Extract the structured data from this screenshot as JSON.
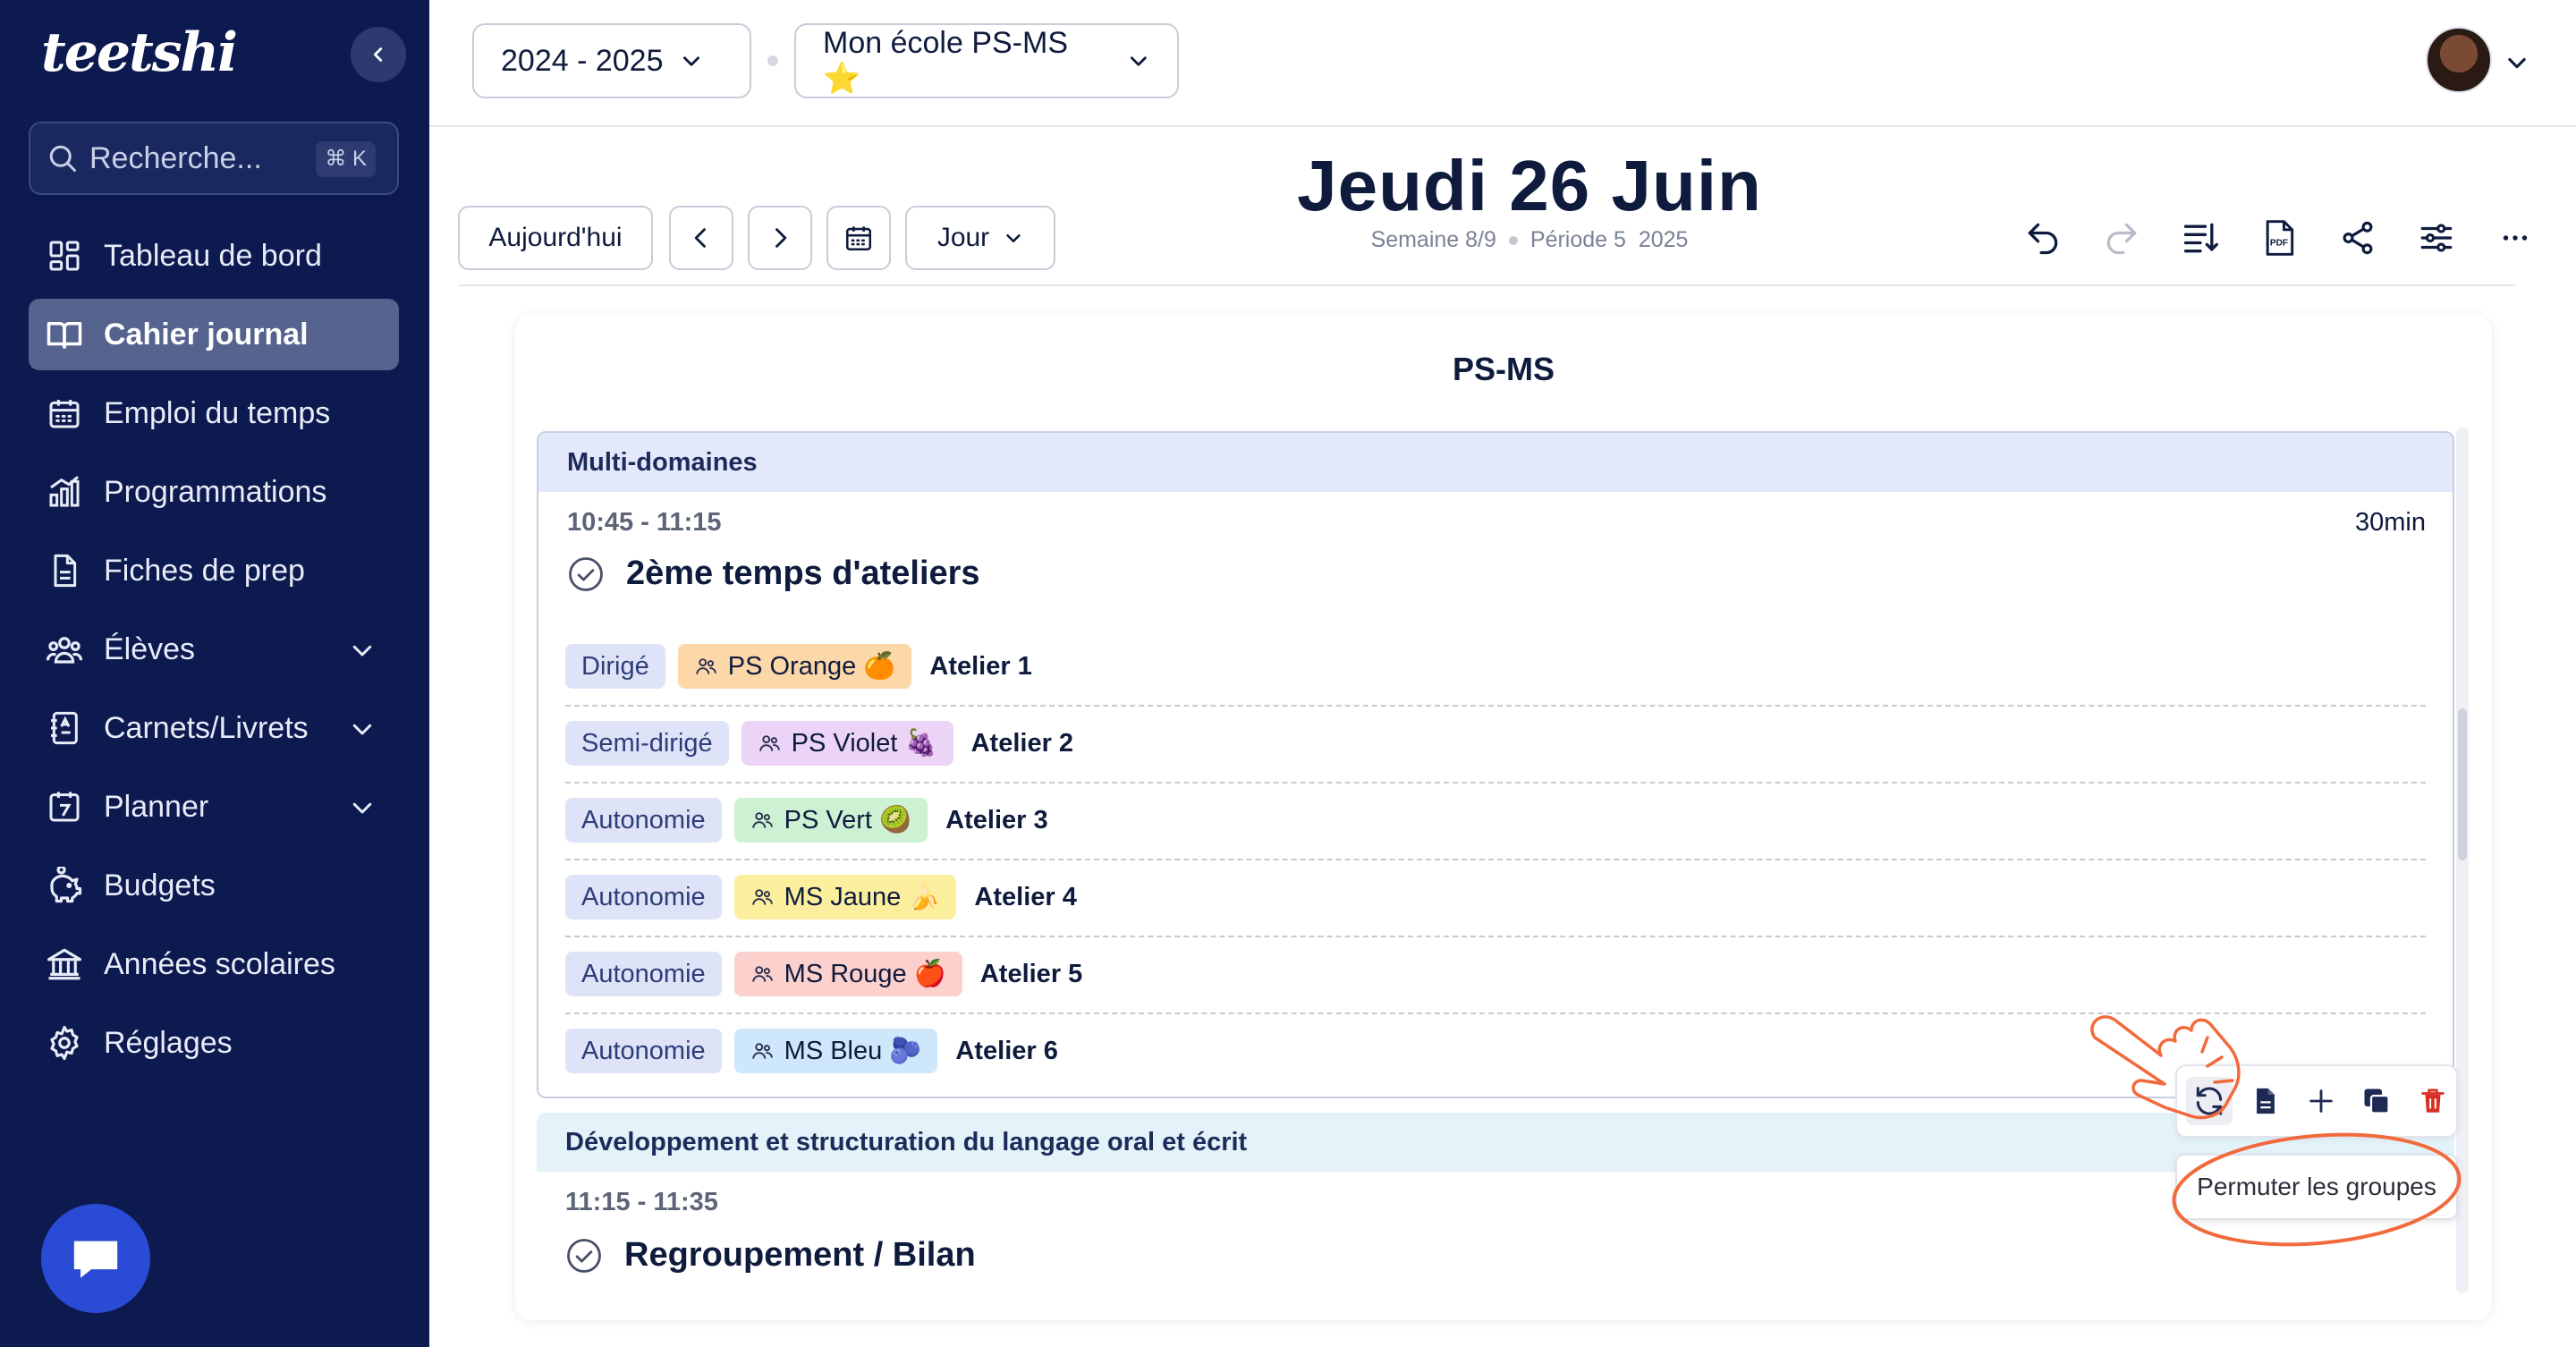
{
  "sidebar": {
    "logo": "teetshi",
    "search_placeholder": "Recherche...",
    "search_shortcut": "⌘ K",
    "items": [
      {
        "label": "Tableau de bord",
        "icon": "dashboard-icon"
      },
      {
        "label": "Cahier journal",
        "icon": "book-open-icon",
        "active": true
      },
      {
        "label": "Emploi du temps",
        "icon": "calendar-icon"
      },
      {
        "label": "Programmations",
        "icon": "bar-chart-icon"
      },
      {
        "label": "Fiches de prep",
        "icon": "document-icon"
      },
      {
        "label": "Élèves",
        "icon": "users-icon",
        "expandable": true
      },
      {
        "label": "Carnets/Livrets",
        "icon": "notebook-icon",
        "expandable": true
      },
      {
        "label": "Planner",
        "icon": "planner-icon",
        "expandable": true
      },
      {
        "label": "Budgets",
        "icon": "piggy-bank-icon"
      },
      {
        "label": "Années scolaires",
        "icon": "bank-icon"
      },
      {
        "label": "Réglages",
        "icon": "gear-icon"
      }
    ]
  },
  "topbar": {
    "year": "2024 - 2025",
    "school": "Mon école PS-MS ⭐"
  },
  "toolbar": {
    "today": "Aujourd'hui",
    "view": "Jour",
    "title": "Jeudi 26 Juin",
    "week": "Semaine 8/9",
    "period": "Période 5",
    "year": "2025"
  },
  "card": {
    "class_name": "PS-MS",
    "sequences": [
      {
        "domain": "Multi-domaines",
        "time": "10:45 - 11:15",
        "duration": "30min",
        "title": "2ème temps d'ateliers",
        "rows": [
          {
            "type": "Dirigé",
            "group": "PS Orange 🍊",
            "group_color": "#fcd7a8",
            "atelier": "Atelier 1"
          },
          {
            "type": "Semi-dirigé",
            "group": "PS Violet 🍇",
            "group_color": "#ecd4f7",
            "atelier": "Atelier 2"
          },
          {
            "type": "Autonomie",
            "group": "PS Vert 🥝",
            "group_color": "#cdf1d3",
            "atelier": "Atelier 3"
          },
          {
            "type": "Autonomie",
            "group": "MS Jaune 🍌",
            "group_color": "#fbef9e",
            "atelier": "Atelier 4"
          },
          {
            "type": "Autonomie",
            "group": "MS Rouge 🍎",
            "group_color": "#fbd0cd",
            "atelier": "Atelier 5"
          },
          {
            "type": "Autonomie",
            "group": "MS Bleu 🫐",
            "group_color": "#cfe7fb",
            "atelier": "Atelier 6"
          }
        ]
      },
      {
        "domain": "Développement et structuration du langage oral et écrit",
        "time": "11:15 - 11:35",
        "title": "Regroupement / Bilan"
      }
    ]
  },
  "actions": {
    "tooltip": "Permuter les groupes"
  },
  "colors": {
    "sidebar_bg": "#0d1a4f",
    "accent_orange": "#f26a3c",
    "chat_blue": "#2a4bd6",
    "delete_red": "#d93025"
  }
}
